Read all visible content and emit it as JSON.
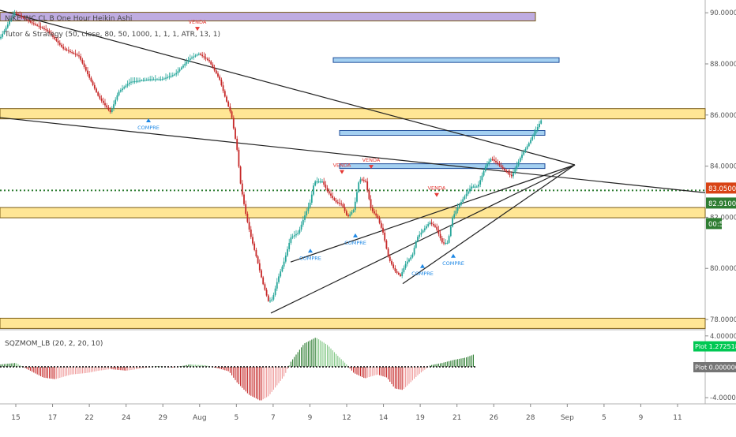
{
  "chart_data": [
    {
      "type": "candlestick",
      "symbol_legend": "NIKE INC CL B  One Hour  Heikin Ashi",
      "strategy_legend": "Tutor & Strategy (50, close, 80, 50, 1000, 1, 1, 1, ATR, 13, 1)",
      "x_ticks": [
        "15",
        "17",
        "22",
        "24",
        "29",
        "Aug",
        "5",
        "7",
        "9",
        "12",
        "14",
        "19",
        "21",
        "26",
        "28",
        "Sep",
        "5",
        "9",
        "11"
      ],
      "y_ticks": [
        78.0,
        80.0,
        82.0,
        84.0,
        86.0,
        88.0,
        90.0
      ],
      "ylim": [
        77.6,
        90.5
      ],
      "price_badges": {
        "last": "83.05000000",
        "level": "82.91000000",
        "countdown": "00:58"
      },
      "horizontal_levels": [
        {
          "y": 86.05,
          "color": "#ffd54f"
        },
        {
          "y": 82.18,
          "color": "#ffd54f"
        },
        {
          "y": 77.85,
          "color": "#ffd54f"
        },
        {
          "y": 89.85,
          "color": "#9575cd"
        },
        {
          "y": 88.15,
          "color": "#5aa9e6"
        },
        {
          "y": 85.3,
          "color": "#5aa9e6"
        },
        {
          "y": 84.0,
          "color": "#5aa9e6"
        }
      ],
      "dotted_level": 83.05,
      "trendlines": [
        {
          "x0": 0,
          "y0": 90.1,
          "x1": 728,
          "y1": 84.05
        },
        {
          "x0": 0,
          "y0": 85.9,
          "x1": 893,
          "y1": 82.96
        },
        {
          "x0": 343,
          "y0": 78.25,
          "x1": 728,
          "y1": 84.05
        },
        {
          "x0": 368,
          "y0": 80.25,
          "x1": 728,
          "y1": 84.05
        },
        {
          "x0": 510,
          "y0": 79.4,
          "x1": 728,
          "y1": 84.05
        }
      ],
      "path": [
        [
          0,
          89.0
        ],
        [
          18,
          90.0
        ],
        [
          40,
          89.6
        ],
        [
          60,
          89.3
        ],
        [
          80,
          88.6
        ],
        [
          100,
          88.3
        ],
        [
          125,
          86.7
        ],
        [
          140,
          86.1
        ],
        [
          150,
          86.9
        ],
        [
          165,
          87.3
        ],
        [
          190,
          87.4
        ],
        [
          205,
          87.4
        ],
        [
          222,
          87.6
        ],
        [
          240,
          88.2
        ],
        [
          252,
          88.4
        ],
        [
          265,
          88.1
        ],
        [
          278,
          87.4
        ],
        [
          285,
          86.7
        ],
        [
          293,
          86.0
        ],
        [
          300,
          84.7
        ],
        [
          305,
          83.2
        ],
        [
          312,
          82.0
        ],
        [
          318,
          81.2
        ],
        [
          325,
          80.4
        ],
        [
          333,
          79.4
        ],
        [
          340,
          78.7
        ],
        [
          345,
          78.8
        ],
        [
          352,
          79.6
        ],
        [
          360,
          80.3
        ],
        [
          368,
          81.2
        ],
        [
          378,
          81.4
        ],
        [
          385,
          82.0
        ],
        [
          393,
          82.6
        ],
        [
          398,
          83.4
        ],
        [
          408,
          83.4
        ],
        [
          415,
          83.0
        ],
        [
          425,
          82.6
        ],
        [
          433,
          82.5
        ],
        [
          440,
          82.0
        ],
        [
          448,
          82.3
        ],
        [
          455,
          83.5
        ],
        [
          463,
          83.4
        ],
        [
          470,
          82.3
        ],
        [
          478,
          82.0
        ],
        [
          485,
          81.4
        ],
        [
          492,
          80.4
        ],
        [
          500,
          79.9
        ],
        [
          507,
          79.7
        ],
        [
          514,
          80.2
        ],
        [
          522,
          80.5
        ],
        [
          528,
          81.2
        ],
        [
          536,
          81.5
        ],
        [
          544,
          81.8
        ],
        [
          552,
          81.6
        ],
        [
          560,
          81.0
        ],
        [
          567,
          81.0
        ],
        [
          573,
          82.0
        ],
        [
          580,
          82.4
        ],
        [
          588,
          82.8
        ],
        [
          597,
          83.2
        ],
        [
          605,
          83.2
        ],
        [
          615,
          84.0
        ],
        [
          622,
          84.3
        ],
        [
          630,
          84.1
        ],
        [
          640,
          83.8
        ],
        [
          648,
          83.6
        ],
        [
          660,
          84.4
        ],
        [
          668,
          84.8
        ],
        [
          675,
          85.2
        ],
        [
          682,
          85.6
        ],
        [
          687,
          85.9
        ]
      ],
      "signals": [
        {
          "text": "VENDA",
          "x": 250,
          "y": 89.2,
          "side": "sell"
        },
        {
          "text": "VENDA",
          "x": 433,
          "y": 83.6,
          "side": "sell"
        },
        {
          "text": "VENDA",
          "x": 470,
          "y": 83.8,
          "side": "sell"
        },
        {
          "text": "VENDA",
          "x": 553,
          "y": 82.7,
          "side": "sell"
        },
        {
          "text": "COMPRE",
          "x": 188,
          "y": 85.9,
          "side": "buy"
        },
        {
          "text": "COMPRE",
          "x": 393,
          "y": 80.8,
          "side": "buy"
        },
        {
          "text": "COMPRE",
          "x": 450,
          "y": 81.4,
          "side": "buy"
        },
        {
          "text": "COMPRE",
          "x": 535,
          "y": 80.2,
          "side": "buy"
        },
        {
          "text": "COMPRE",
          "x": 574,
          "y": 80.6,
          "side": "buy"
        }
      ]
    },
    {
      "type": "histogram",
      "legend": "SQZMOM_LB (20, 2, 20, 10)",
      "badges": [
        "Plot  1.27251827",
        "Plot  0.00000000"
      ],
      "y_ticks": [
        4.0,
        0.0,
        -4.0
      ],
      "ylim": [
        -4.8,
        4.8
      ],
      "segments": [
        [
          0,
          0.3
        ],
        [
          20,
          0.5
        ],
        [
          40,
          -0.6
        ],
        [
          55,
          -1.4
        ],
        [
          70,
          -1.6
        ],
        [
          90,
          -1.0
        ],
        [
          110,
          -0.8
        ],
        [
          125,
          -0.5
        ],
        [
          140,
          -0.3
        ],
        [
          160,
          -0.5
        ],
        [
          180,
          -0.2
        ],
        [
          200,
          0.1
        ],
        [
          220,
          -0.1
        ],
        [
          240,
          0.3
        ],
        [
          260,
          0.2
        ],
        [
          280,
          -0.3
        ],
        [
          290,
          -0.6
        ],
        [
          300,
          -2.0
        ],
        [
          315,
          -3.6
        ],
        [
          330,
          -4.4
        ],
        [
          340,
          -3.8
        ],
        [
          350,
          -2.5
        ],
        [
          360,
          -1.2
        ],
        [
          368,
          0.6
        ],
        [
          385,
          3.0
        ],
        [
          400,
          3.8
        ],
        [
          415,
          2.8
        ],
        [
          428,
          1.4
        ],
        [
          438,
          0.4
        ],
        [
          448,
          -0.8
        ],
        [
          462,
          -1.5
        ],
        [
          478,
          -1.0
        ],
        [
          490,
          -1.4
        ],
        [
          500,
          -2.8
        ],
        [
          510,
          -3.0
        ],
        [
          518,
          -2.2
        ],
        [
          530,
          -1.0
        ],
        [
          545,
          0.2
        ],
        [
          560,
          0.5
        ],
        [
          575,
          0.9
        ],
        [
          590,
          1.2
        ],
        [
          600,
          1.6
        ]
      ]
    }
  ]
}
